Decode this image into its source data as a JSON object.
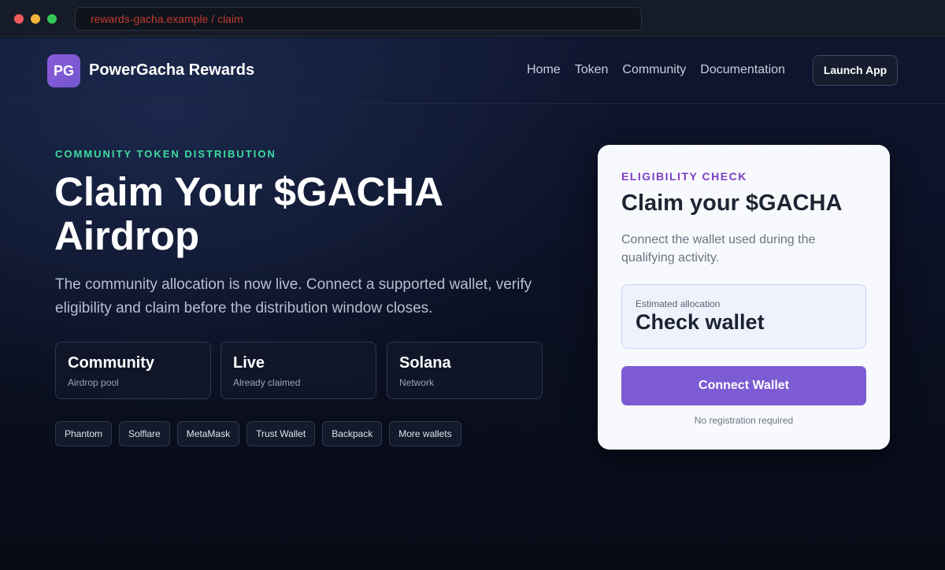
{
  "browser": {
    "url": "rewards-gacha.example / claim"
  },
  "nav": {
    "logo_text": "PG",
    "brand": "PowerGacha Rewards",
    "links": [
      "Home",
      "Token",
      "Community",
      "Documentation"
    ],
    "launch_label": "Launch App"
  },
  "hero": {
    "eyebrow": "COMMUNITY TOKEN DISTRIBUTION",
    "title": "Claim Your $GACHA Airdrop",
    "description": "The community allocation is now live. Connect a supported wallet, verify eligibility and claim before the distribution window closes.",
    "stats": [
      {
        "title": "Community",
        "subtitle": "Airdrop pool"
      },
      {
        "title": "Live",
        "subtitle": "Already claimed"
      },
      {
        "title": "Solana",
        "subtitle": "Network"
      }
    ],
    "wallets": [
      "Phantom",
      "Solflare",
      "MetaMask",
      "Trust Wallet",
      "Backpack",
      "More wallets"
    ]
  },
  "claim_card": {
    "eyebrow": "ELIGIBILITY CHECK",
    "title": "Claim your $GACHA",
    "description": "Connect the wallet used during the qualifying activity.",
    "allocation_label": "Estimated allocation",
    "allocation_value": "Check wallet",
    "connect_label": "Connect Wallet",
    "footnote": "No registration required"
  }
}
